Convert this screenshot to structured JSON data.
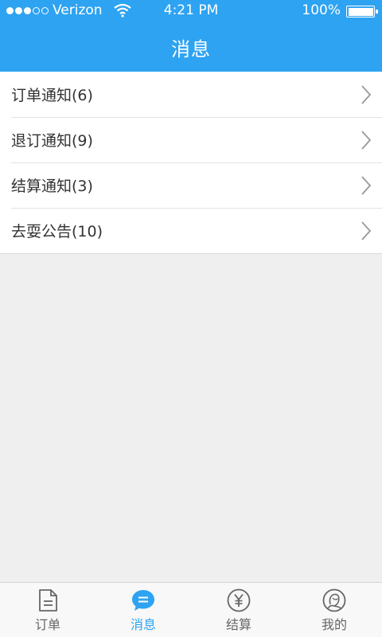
{
  "status_bar": {
    "carrier": "Verizon",
    "time": "4:21 PM",
    "battery": "100%"
  },
  "header": {
    "title": "消息"
  },
  "messages": [
    {
      "label": "订单通知(6)"
    },
    {
      "label": "退订通知(9)"
    },
    {
      "label": "结算通知(3)"
    },
    {
      "label": "去耍公告(10)"
    }
  ],
  "tabbar": {
    "tabs": [
      {
        "label": "订单",
        "icon": "document-icon"
      },
      {
        "label": "消息",
        "icon": "chat-bubble-icon",
        "active": true
      },
      {
        "label": "结算",
        "icon": "yen-icon"
      },
      {
        "label": "我的",
        "icon": "profile-icon"
      }
    ]
  },
  "colors": {
    "accent": "#2ea3f2",
    "background": "#efefef",
    "inactive_tab": "#666666"
  }
}
